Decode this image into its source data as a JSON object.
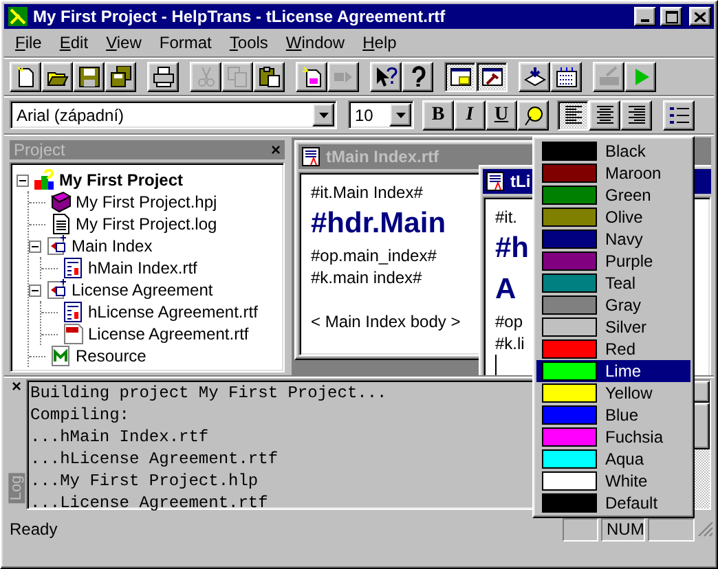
{
  "window": {
    "title": "My First Project - HelpTrans - tLicense Agreement.rtf"
  },
  "menu": [
    {
      "label": "File",
      "underline_first": true
    },
    {
      "label": "Edit",
      "underline_first": true
    },
    {
      "label": "View",
      "underline_first": true
    },
    {
      "label": "Format",
      "underline_first": false
    },
    {
      "label": "Tools",
      "underline_first": true
    },
    {
      "label": "Window",
      "underline_first": true
    },
    {
      "label": "Help",
      "underline_first": true
    }
  ],
  "toolbar": [
    [
      {
        "kind": "new",
        "disabled": false,
        "pressed": false
      },
      {
        "kind": "open",
        "disabled": false,
        "pressed": false
      },
      {
        "kind": "save",
        "disabled": false,
        "pressed": false
      },
      {
        "kind": "save_all",
        "disabled": false,
        "pressed": false
      }
    ],
    [
      {
        "kind": "print",
        "disabled": false,
        "pressed": false
      }
    ],
    [
      {
        "kind": "cut",
        "disabled": true,
        "pressed": false
      },
      {
        "kind": "copy",
        "disabled": true,
        "pressed": false
      },
      {
        "kind": "paste",
        "disabled": false,
        "pressed": false
      }
    ],
    [
      {
        "kind": "new_topic",
        "disabled": false,
        "pressed": false
      },
      {
        "kind": "convert",
        "disabled": true,
        "pressed": false
      }
    ],
    [
      {
        "kind": "context_help",
        "disabled": false,
        "pressed": false
      },
      {
        "kind": "help",
        "disabled": false,
        "pressed": false
      }
    ],
    [
      {
        "kind": "project_window",
        "disabled": false,
        "pressed": true
      },
      {
        "kind": "compile_window",
        "disabled": false,
        "pressed": true
      }
    ],
    [
      {
        "kind": "import",
        "disabled": false,
        "pressed": false
      },
      {
        "kind": "keywords",
        "disabled": false,
        "pressed": false
      }
    ],
    [
      {
        "kind": "edit",
        "disabled": true,
        "pressed": false
      },
      {
        "kind": "run",
        "disabled": false,
        "pressed": false
      }
    ]
  ],
  "format_bar": {
    "font": "Arial (západní)",
    "size": "10",
    "styles": [
      {
        "kind": "bold",
        "label": "B"
      },
      {
        "kind": "italic",
        "label": "I"
      },
      {
        "kind": "underline",
        "label": "U"
      }
    ],
    "alignment": [
      {
        "kind": "left",
        "selected": true
      },
      {
        "kind": "center",
        "selected": false
      },
      {
        "kind": "right",
        "selected": false
      }
    ]
  },
  "project": {
    "title": "Project",
    "close": "×",
    "tree": [
      {
        "label": "My First Project",
        "kind": "project",
        "expanded": true,
        "children": [
          {
            "label": "My First Project.hpj",
            "kind": "book"
          },
          {
            "label": "My First Project.log",
            "kind": "log"
          },
          {
            "label": "Main Index",
            "kind": "topic",
            "expanded": true,
            "children": [
              {
                "label": "hMain Index.rtf",
                "kind": "rtf"
              }
            ]
          },
          {
            "label": "License Agreement",
            "kind": "topic",
            "expanded": true,
            "children": [
              {
                "label": "hLicense Agreement.rtf",
                "kind": "rtf"
              },
              {
                "label": "License Agreement.rtf",
                "kind": "doc"
              }
            ]
          },
          {
            "label": "Resource",
            "kind": "resource"
          }
        ]
      }
    ]
  },
  "documents": [
    {
      "title": "tMain Index.rtf",
      "active": false,
      "lines": [
        {
          "kind": "code",
          "text": "#it.Main Index#"
        },
        {
          "kind": "heading",
          "text": "#hdr.Main"
        },
        {
          "kind": "code",
          "text": "#op.main_index#"
        },
        {
          "kind": "code",
          "text": "#k.main index#"
        },
        {
          "kind": "body",
          "text": "< Main Index body >"
        }
      ]
    },
    {
      "title": "tLi",
      "active": true,
      "lines": [
        {
          "kind": "code",
          "text": "#it."
        },
        {
          "kind": "heading",
          "text": "#h"
        },
        {
          "kind": "heading",
          "text": "A"
        },
        {
          "kind": "code",
          "text": "#op"
        },
        {
          "kind": "code",
          "text": "#k.li"
        },
        {
          "kind": "cursor"
        }
      ]
    }
  ],
  "color_menu": [
    {
      "name": "Black",
      "color": "#000000",
      "selected": false
    },
    {
      "name": "Maroon",
      "color": "#800000",
      "selected": false
    },
    {
      "name": "Green",
      "color": "#008000",
      "selected": false
    },
    {
      "name": "Olive",
      "color": "#808000",
      "selected": false
    },
    {
      "name": "Navy",
      "color": "#000080",
      "selected": false
    },
    {
      "name": "Purple",
      "color": "#800080",
      "selected": false
    },
    {
      "name": "Teal",
      "color": "#008080",
      "selected": false
    },
    {
      "name": "Gray",
      "color": "#808080",
      "selected": false
    },
    {
      "name": "Silver",
      "color": "#c0c0c0",
      "selected": false
    },
    {
      "name": "Red",
      "color": "#ff0000",
      "selected": false
    },
    {
      "name": "Lime",
      "color": "#00ff00",
      "selected": true
    },
    {
      "name": "Yellow",
      "color": "#ffff00",
      "selected": false
    },
    {
      "name": "Blue",
      "color": "#0000ff",
      "selected": false
    },
    {
      "name": "Fuchsia",
      "color": "#ff00ff",
      "selected": false
    },
    {
      "name": "Aqua",
      "color": "#00ffff",
      "selected": false
    },
    {
      "name": "White",
      "color": "#ffffff",
      "selected": false
    },
    {
      "name": "Default",
      "color": "#000000",
      "selected": false
    }
  ],
  "log": {
    "close": "×",
    "title": "Log",
    "lines": [
      "Building project My First Project...",
      "Compiling:",
      "...hMain Index.rtf",
      "...hLicense Agreement.rtf",
      "...My First Project.hlp",
      "...License Agreement.rtf"
    ]
  },
  "status_bar": {
    "text": "Ready",
    "indicator": "NUM"
  }
}
